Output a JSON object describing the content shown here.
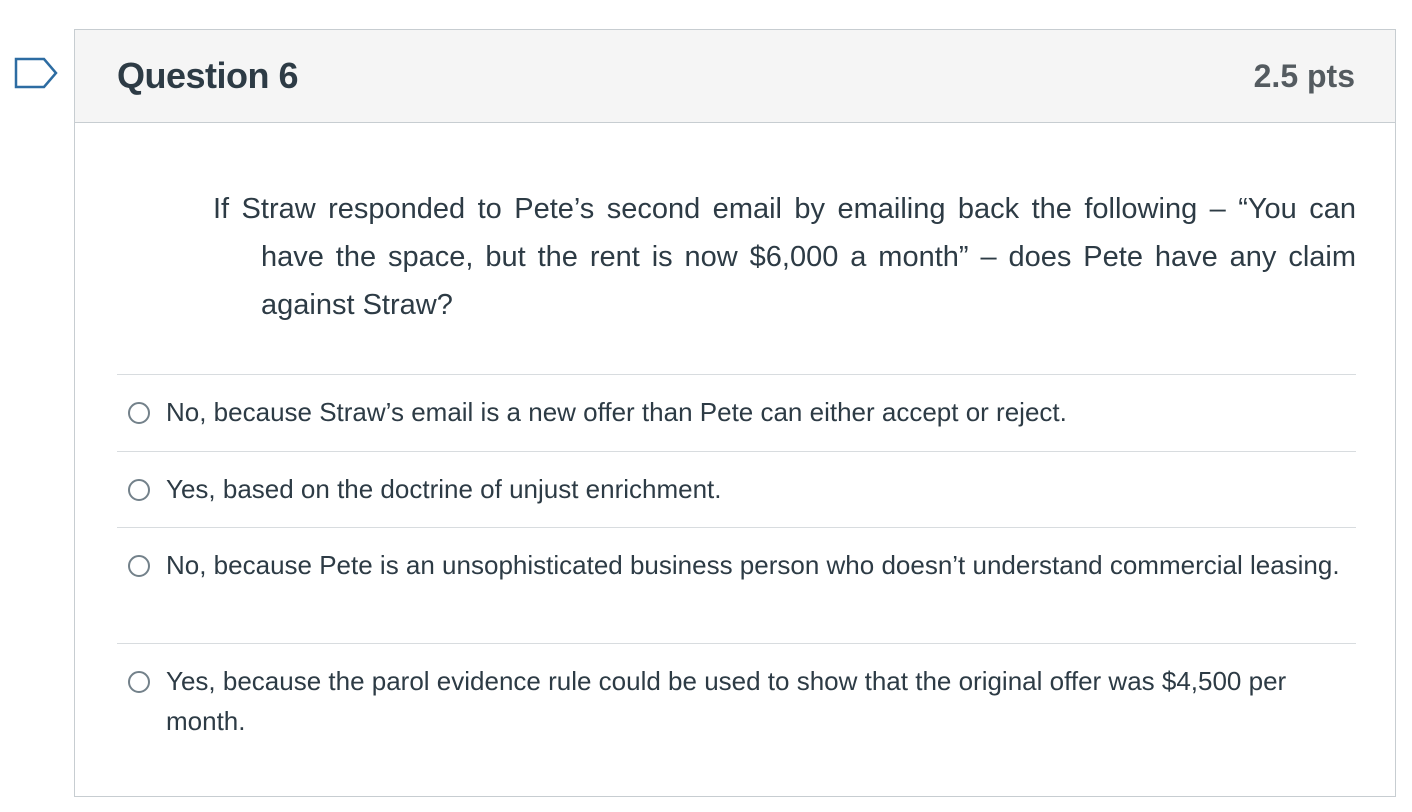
{
  "question": {
    "title": "Question 6",
    "points": "2.5 pts",
    "text": "If Straw responded to Pete’s second email by emailing back the following – “You can have the space, but the rent is now $6,000 a month” – does Pete have any claim against Straw?"
  },
  "flag": {
    "icon": "flag-question-icon",
    "color": "#2d6ca2"
  },
  "answers": [
    {
      "label": "No, because Straw’s email is a new offer than Pete can either accept or reject."
    },
    {
      "label": "Yes, based on the doctrine of unjust enrichment."
    },
    {
      "label": "No, because Pete is an unsophisticated business person who doesn’t understand commercial leasing."
    },
    {
      "label": "Yes, because the parol evidence rule could be used to show that the original offer was $4,500 per month."
    }
  ]
}
